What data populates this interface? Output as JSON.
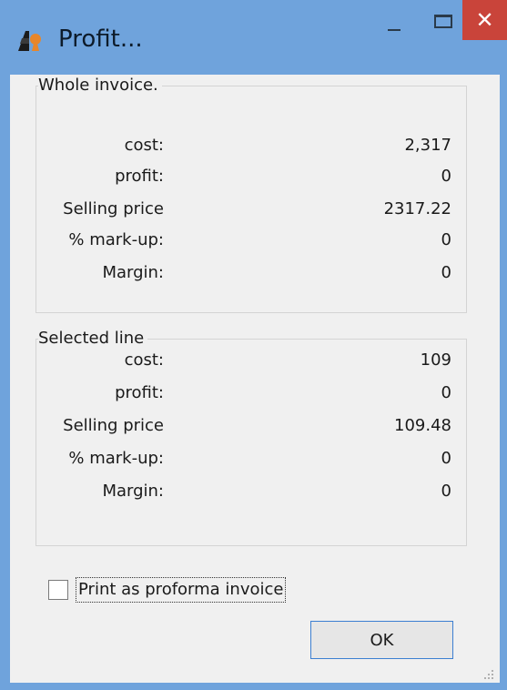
{
  "window": {
    "title": "Profit...",
    "close_glyph": "✕",
    "controls": [
      "minimize-icon",
      "maximize-icon",
      "close-icon"
    ]
  },
  "whole_invoice": {
    "legend": "Whole invoice.",
    "rows": [
      {
        "label": "cost:",
        "value": "2,317"
      },
      {
        "label": "profit:",
        "value": "0"
      },
      {
        "label": "Selling price",
        "value": "2317.22"
      },
      {
        "label": "% mark-up:",
        "value": "0"
      },
      {
        "label": "Margin:",
        "value": "0"
      }
    ]
  },
  "selected_line": {
    "legend": "Selected line",
    "rows": [
      {
        "label": "cost:",
        "value": "109"
      },
      {
        "label": "profit:",
        "value": "0"
      },
      {
        "label": "Selling price",
        "value": "109.48"
      },
      {
        "label": "% mark-up:",
        "value": "0"
      },
      {
        "label": "Margin:",
        "value": "0"
      }
    ]
  },
  "proforma_checkbox": {
    "label": "Print as proforma invoice",
    "checked": false
  },
  "ok_button": {
    "label": "OK"
  },
  "colors": {
    "titlebar": "#6fa3dc",
    "close": "#c9443a",
    "dialog_bg": "#f0f0f0"
  }
}
